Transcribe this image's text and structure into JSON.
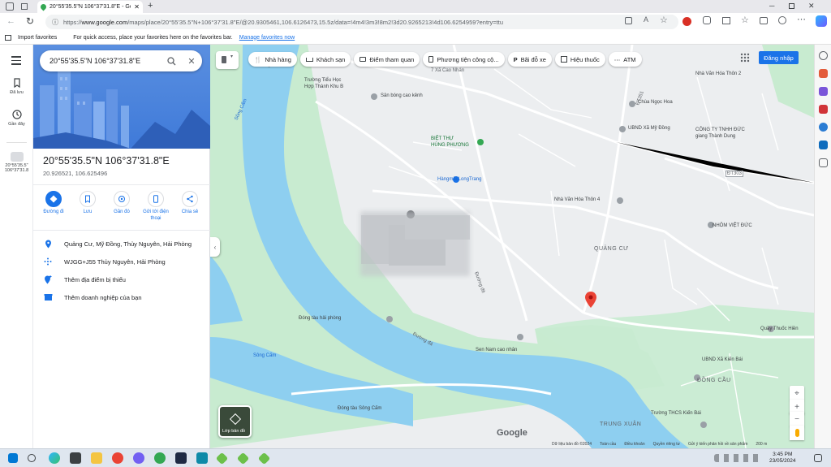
{
  "browser": {
    "tab_title": "20°55'35.5\"N 106°37'31.8\"E - Go...",
    "url_prefix": "https://",
    "url_host": "www.google.com",
    "url_path": "/maps/place/20°55'35.5\"N+106°37'31.8\"E/@20.9305461,106.6126473,15.5z/data=!4m4!3m3!8m2!3d20.9265213!4d106.6254959?entry=ttu",
    "favorites_import": "Import favorites",
    "favorites_hint": "For quick access, place your favorites here on the favorites bar.",
    "favorites_link": "Manage favorites now"
  },
  "rail": {
    "saved": "Đã lưu",
    "recent": "Gần đây",
    "recent_item_line1": "20°55'35.5\"",
    "recent_item_line2": "106°37'31.8"
  },
  "panel": {
    "search_value": "20°55'35.5\"N 106°37'31.8\"E",
    "title": "20°55'35.5\"N 106°37'31.8\"E",
    "coords": "20.926521, 106.625496",
    "actions": [
      {
        "label": "Đường đi"
      },
      {
        "label": "Lưu"
      },
      {
        "label": "Gần đó"
      },
      {
        "label": "Gửi tới điện thoại"
      },
      {
        "label": "Chia sẻ"
      }
    ],
    "info": [
      {
        "text": "Quảng Cư, Mỹ Đồng, Thủy Nguyên, Hải Phòng"
      },
      {
        "text": "WJGG+J55 Thủy Nguyên, Hải Phòng"
      },
      {
        "text": "Thêm địa điểm bị thiếu"
      },
      {
        "text": "Thêm doanh nghiệp của bạn"
      }
    ]
  },
  "map": {
    "chips": [
      "Nhà hàng",
      "Khách sạn",
      "Điểm tham quan",
      "Phương tiện công cộ...",
      "Bãi đỗ xe",
      "Hiệu thuốc",
      "ATM"
    ],
    "signin": "Đăng nhập",
    "layer_label": "Lớp bản đồ",
    "labels": {
      "school": "Trường Tiểu Học",
      "school2": "Hợp Thành Khu B",
      "xa_cao_nhan": "7 Xã Cao Nhân",
      "football": "Sân bóng cao kênh",
      "villa": "BIỆT THỰ",
      "villa2": "HÙNG PHƯƠNG",
      "hang_mai": "Hàngmãi.LongTrang",
      "nvh_thon2": "Nhà Văn Hóa Thôn 2",
      "chua": "Chùa Ngọc Hoa",
      "ubnd_my_dong": "UBND Xã Mỹ Đồng",
      "cty_thanh_duc": "CÔNG TY TNHH ĐỨC",
      "cty_thanh_duc2": "giang Thành Dung",
      "nvh_thon4": "Nhà Văn Hóa Thôn 4",
      "quang_cu": "QUẢNG CƯ",
      "nhom": "NHÔM VIỆT ĐỨC",
      "dong_tau_hp": "Đóng tàu hải phòng",
      "sen_nam": "Sen Nam cao nhân",
      "quay_thuoc": "Quầy Thuốc Hiền",
      "ubnd_kien_bai": "UBND Xã Kiến Bái",
      "dong_cau": "ĐỒNG CẦU",
      "truong_thcs": "Trường THCS Kiến Bái",
      "trung_xuan": "TRUNG XUÂN",
      "dong_tau_song_cam": "Đóng tàu Sông Cấm",
      "song_cam": "Sông Cấm",
      "song_cam2": "Sông Cấm",
      "cong_truong": "Công Tr",
      "duong_da": "Đường đá",
      "duong_de": "Đường đê",
      "road_303": "ĐT303",
      "road_351": "ĐT351",
      "google": "Google"
    },
    "footer": [
      "Dữ liệu bản đồ ©2024",
      "Toàn cầu",
      "Điều khoản",
      "Quyền riêng tư",
      "Gửi ý kiến phản hồi về sản phẩm",
      "200 m"
    ]
  },
  "taskbar": {
    "time": "3:45 PM",
    "date": "23/05/2024"
  },
  "colors": {
    "accent": "#1a73e8",
    "panel_hero": "#4a84de",
    "water": "#8ecff0",
    "park": "#c8ebd0",
    "pin": "#ea4335"
  }
}
